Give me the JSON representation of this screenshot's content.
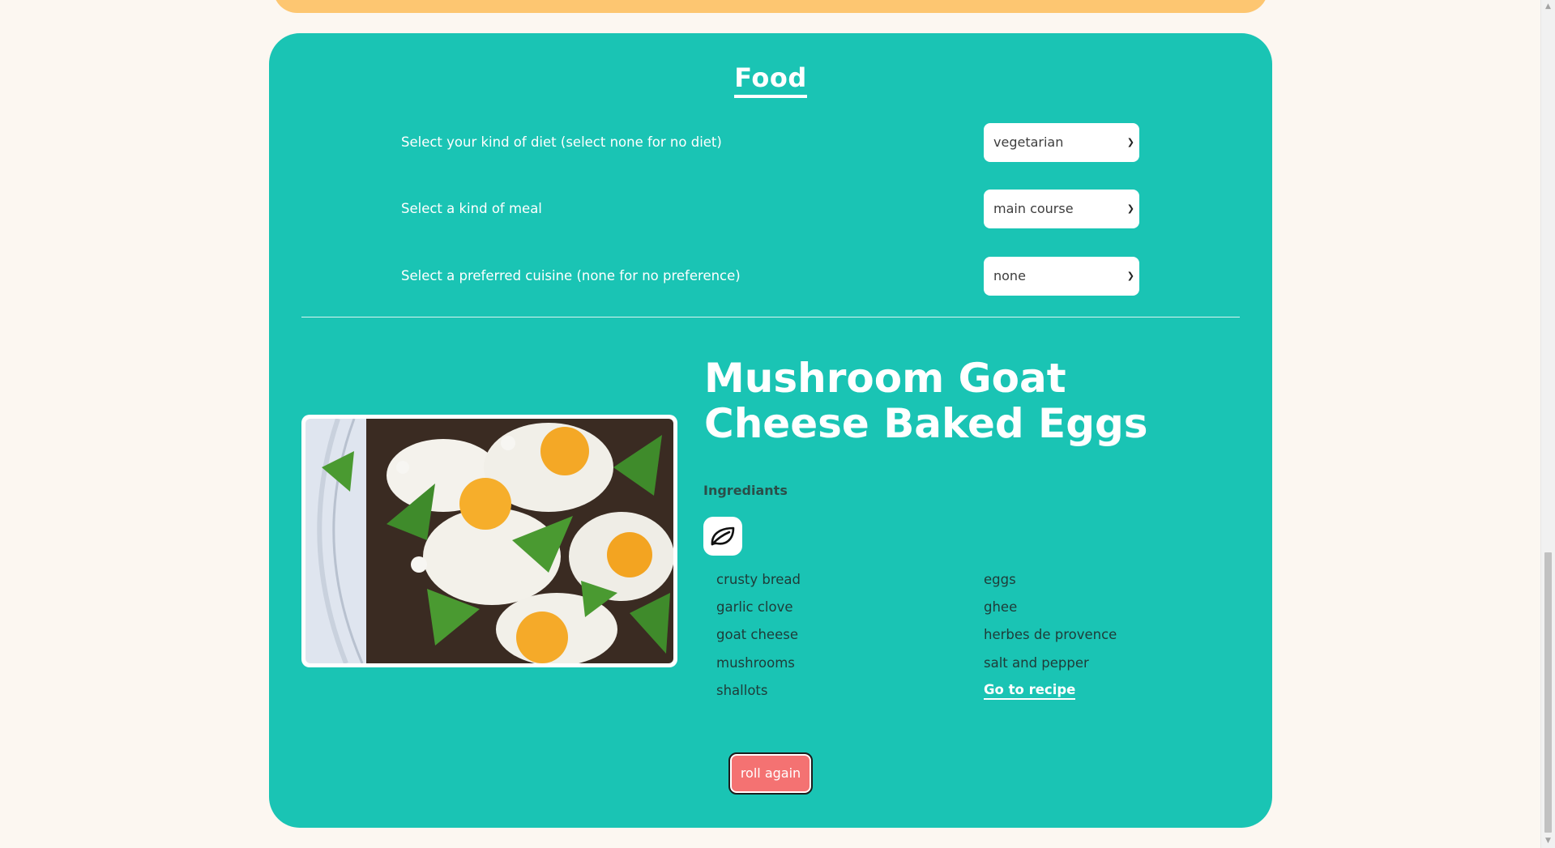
{
  "food": {
    "title": "Food",
    "filters": [
      {
        "label": "Select your kind of diet (select none for no diet)",
        "value": "vegetarian"
      },
      {
        "label": "Select a kind of meal",
        "value": "main course"
      },
      {
        "label": "Select a preferred cuisine (none for no preference)",
        "value": "none"
      }
    ]
  },
  "recipe": {
    "title": "Mushroom Goat Cheese Baked Eggs",
    "ingredients_heading": "Ingrediants",
    "diet_icon": "leaf-icon",
    "ingredients_left": [
      "crusty bread",
      "garlic clove",
      "goat cheese",
      "mushrooms",
      "shallots"
    ],
    "ingredients_right": [
      "eggs",
      "ghee",
      "herbes de provence",
      "salt and pepper"
    ],
    "link_label": "Go to recipe",
    "roll_label": "roll again"
  },
  "colors": {
    "card_background": "#1ac4b4",
    "page_background": "#fcf7f1",
    "top_card": "#fdc671",
    "roll_button": "#f47272"
  }
}
